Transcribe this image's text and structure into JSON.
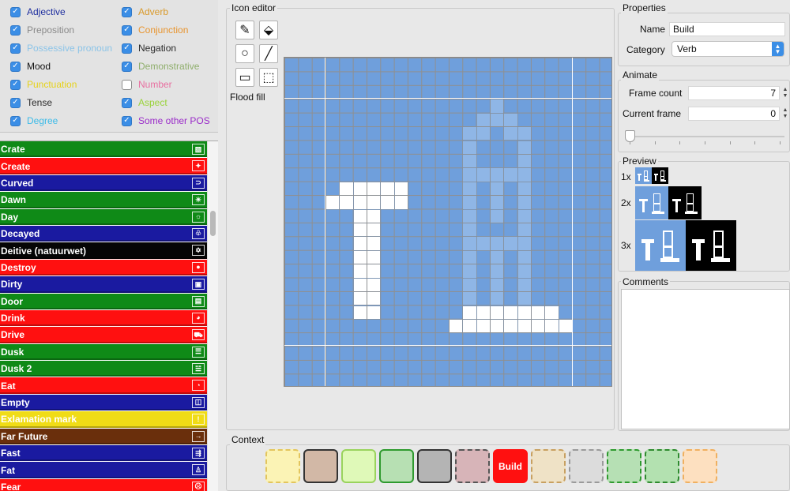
{
  "filters": [
    {
      "label": "Adjective",
      "checked": true,
      "color": "#1f2f9f"
    },
    {
      "label": "Adverb",
      "checked": true,
      "color": "#d99a2b"
    },
    {
      "label": "Preposition",
      "checked": true,
      "color": "#8a8a8a"
    },
    {
      "label": "Conjunction",
      "checked": true,
      "color": "#e8942e"
    },
    {
      "label": "Possessive pronoun",
      "checked": true,
      "color": "#8cc4e8"
    },
    {
      "label": "Negation",
      "checked": true,
      "color": "#2a2a2a"
    },
    {
      "label": "Mood",
      "checked": true,
      "color": "#111111"
    },
    {
      "label": "Demonstrative",
      "checked": true,
      "color": "#8fae6c"
    },
    {
      "label": "Punctuation",
      "checked": true,
      "color": "#e6d21a"
    },
    {
      "label": "Number",
      "checked": false,
      "color": "#e86fa0"
    },
    {
      "label": "Tense",
      "checked": true,
      "color": "#2a2a2a"
    },
    {
      "label": "Aspect",
      "checked": true,
      "color": "#9ad33a"
    },
    {
      "label": "Degree",
      "checked": true,
      "color": "#3bbbe8"
    },
    {
      "label": "Some other POS",
      "checked": true,
      "color": "#9a2bc9"
    }
  ],
  "word_list": [
    {
      "label": "Crate",
      "color": "#0f8a17",
      "icon": "crate-icon",
      "glyph": "▨"
    },
    {
      "label": "Create",
      "color": "#ff1010",
      "icon": "create-icon",
      "glyph": "✦"
    },
    {
      "label": "Curved",
      "color": "#1a1aa0",
      "icon": "curved-icon",
      "glyph": "⊃"
    },
    {
      "label": "Dawn",
      "color": "#0f8a17",
      "icon": "dawn-icon",
      "glyph": "☀"
    },
    {
      "label": "Day",
      "color": "#0f8a17",
      "icon": "day-icon",
      "glyph": "☼"
    },
    {
      "label": "Decayed",
      "color": "#1a1aa0",
      "icon": "decayed-icon",
      "glyph": "♧"
    },
    {
      "label": "Deitive (natuurwet)",
      "color": "#050505",
      "icon": "star-of-david-icon",
      "glyph": "✡"
    },
    {
      "label": "Destroy",
      "color": "#ff1010",
      "icon": "destroy-icon",
      "glyph": "●"
    },
    {
      "label": "Dirty",
      "color": "#1a1aa0",
      "icon": "dirty-icon",
      "glyph": "▣"
    },
    {
      "label": "Door",
      "color": "#0f8a17",
      "icon": "door-icon",
      "glyph": "▤"
    },
    {
      "label": "Drink",
      "color": "#ff1010",
      "icon": "drink-icon",
      "glyph": "◕"
    },
    {
      "label": "Drive",
      "color": "#ff1010",
      "icon": "drive-icon",
      "glyph": "⛟"
    },
    {
      "label": "Dusk",
      "color": "#0f8a17",
      "icon": "dusk-icon",
      "glyph": "☰"
    },
    {
      "label": "Dusk 2",
      "color": "#0f8a17",
      "icon": "dusk-2-icon",
      "glyph": "☱"
    },
    {
      "label": "Eat",
      "color": "#ff1010",
      "icon": "eat-icon",
      "glyph": "◔"
    },
    {
      "label": "Empty",
      "color": "#1a1aa0",
      "icon": "empty-icon",
      "glyph": "◫"
    },
    {
      "label": "Exlamation mark",
      "color": "#f0dc16",
      "icon": "exclamation-icon",
      "glyph": "!"
    },
    {
      "label": "Far Future",
      "color": "#6a2f0c",
      "icon": "far-future-icon",
      "glyph": "→"
    },
    {
      "label": "Fast",
      "color": "#1a1aa0",
      "icon": "fast-icon",
      "glyph": "⇶"
    },
    {
      "label": "Fat",
      "color": "#1a1aa0",
      "icon": "fat-icon",
      "glyph": "♙"
    },
    {
      "label": "Fear",
      "color": "#ff1010",
      "icon": "fear-icon",
      "glyph": "☹"
    }
  ],
  "icon_editor": {
    "title": "Icon editor",
    "tools": [
      {
        "name": "pencil-tool-icon",
        "glyph": "✎"
      },
      {
        "name": "flood-fill-tool-icon",
        "glyph": "⬙"
      },
      {
        "name": "circle-tool-icon",
        "glyph": "○"
      },
      {
        "name": "line-tool-icon",
        "glyph": "╱"
      },
      {
        "name": "rectangle-tool-icon",
        "glyph": "▭"
      },
      {
        "name": "select-tool-icon",
        "glyph": "⬚"
      }
    ],
    "active_tool_label": "Flood fill",
    "grid": {
      "cols": 24,
      "rows": 24
    }
  },
  "properties": {
    "title": "Properties",
    "name_label": "Name",
    "name_value": "Build",
    "category_label": "Category",
    "category_value": "Verb"
  },
  "animate": {
    "title": "Animate",
    "frame_count_label": "Frame count",
    "frame_count_value": "7",
    "current_frame_label": "Current frame",
    "current_frame_value": "0",
    "slider_position": 0
  },
  "preview": {
    "title": "Preview",
    "scales": [
      "1x",
      "2x",
      "3x"
    ]
  },
  "comments": {
    "title": "Comments",
    "text": ""
  },
  "context": {
    "title": "Context",
    "tiles": [
      {
        "fill": "#fbf3b5",
        "border": "#e3c55d",
        "style": "dashed",
        "label": ""
      },
      {
        "fill": "#d2b8a6",
        "border": "#333333",
        "style": "solid",
        "label": ""
      },
      {
        "fill": "#dff9b8",
        "border": "#9ad35d",
        "style": "solid",
        "label": ""
      },
      {
        "fill": "#b7e0b3",
        "border": "#2e9a2e",
        "style": "solid",
        "label": ""
      },
      {
        "fill": "#b4b4b4",
        "border": "#333333",
        "style": "solid",
        "label": ""
      },
      {
        "fill": "#d7b4b8",
        "border": "#555555",
        "style": "dashed",
        "label": ""
      },
      {
        "fill": "#ff1010",
        "border": "#ff1010",
        "style": "solid",
        "label": "Build"
      },
      {
        "fill": "#efe2c6",
        "border": "#c8a060",
        "style": "dashed",
        "label": ""
      },
      {
        "fill": "#dcdcdc",
        "border": "#9a9a9a",
        "style": "dashed",
        "label": ""
      },
      {
        "fill": "#b6e0b4",
        "border": "#2e9a2e",
        "style": "dashed",
        "label": ""
      },
      {
        "fill": "#b3e1b0",
        "border": "#2e8a2e",
        "style": "dashed",
        "label": ""
      },
      {
        "fill": "#fde0c0",
        "border": "#f0b060",
        "style": "dashed",
        "label": ""
      }
    ]
  },
  "colors": {
    "canvas_bg": "#6f9fdc",
    "pixel_on": "#ffffff",
    "pixel_ghost": "#8fb6e6",
    "checkbox_accent": "#3b8ee6"
  }
}
